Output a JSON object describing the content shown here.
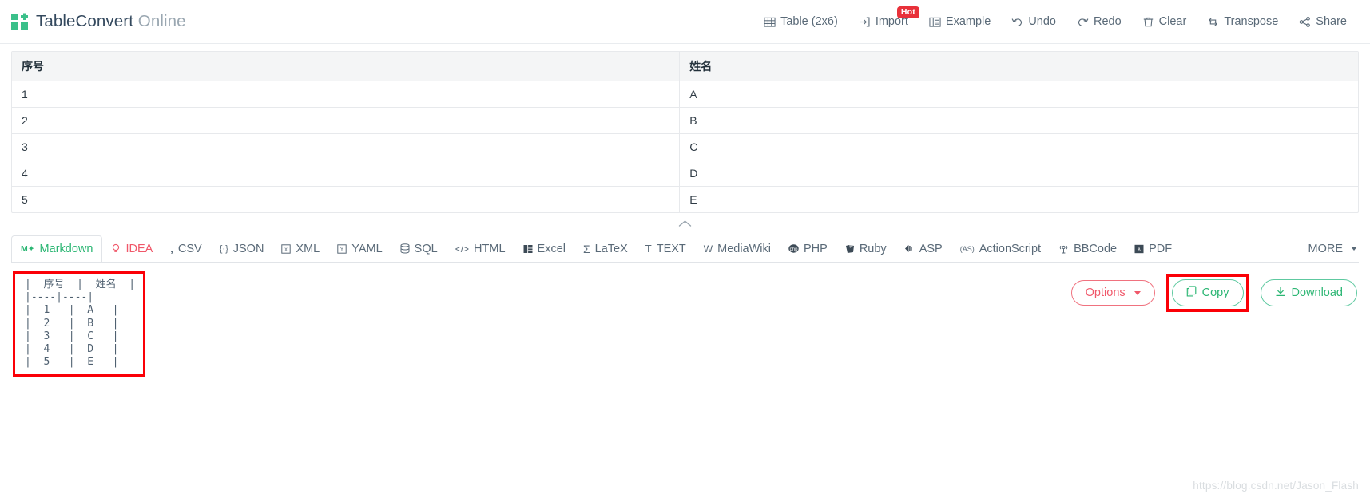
{
  "header": {
    "brand_main": "TableConvert",
    "brand_light": "Online",
    "logo_icon": "grid-squares-logo",
    "tools": [
      {
        "label": "Table (2x6)",
        "icon": "table-icon",
        "badge": null
      },
      {
        "label": "Import",
        "icon": "import-icon",
        "badge": "Hot"
      },
      {
        "label": "Example",
        "icon": "example-icon",
        "badge": null
      },
      {
        "label": "Undo",
        "icon": "undo-arrow-icon",
        "badge": null
      },
      {
        "label": "Redo",
        "icon": "redo-arrow-icon",
        "badge": null
      },
      {
        "label": "Clear",
        "icon": "trash-icon",
        "badge": null
      },
      {
        "label": "Transpose",
        "icon": "transpose-icon",
        "badge": null
      },
      {
        "label": "Share",
        "icon": "share-icon",
        "badge": null
      }
    ]
  },
  "table": {
    "columns": [
      "序号",
      "姓名"
    ],
    "rows": [
      [
        "1",
        "A"
      ],
      [
        "2",
        "B"
      ],
      [
        "3",
        "C"
      ],
      [
        "4",
        "D"
      ],
      [
        "5",
        "E"
      ]
    ]
  },
  "collapse": {
    "icon": "chevron-up-icon"
  },
  "format_tabs": {
    "active": "Markdown",
    "items": [
      {
        "label": "Markdown",
        "icon": "markdown-icon",
        "glyph": "M+",
        "state": "active"
      },
      {
        "label": "IDEA",
        "icon": "idea-bulb-icon",
        "glyph": "⚲",
        "state": "accent"
      },
      {
        "label": "CSV",
        "icon": "csv-comma-icon",
        "glyph": "’",
        "state": "normal"
      },
      {
        "label": "JSON",
        "icon": "json-braces-icon",
        "glyph": "{·}",
        "state": "normal"
      },
      {
        "label": "XML",
        "icon": "xml-icon",
        "glyph": "☒",
        "state": "normal"
      },
      {
        "label": "YAML",
        "icon": "yaml-icon",
        "glyph": "☐",
        "state": "normal"
      },
      {
        "label": "SQL",
        "icon": "database-icon",
        "glyph": "⌸",
        "state": "normal"
      },
      {
        "label": "HTML",
        "icon": "code-tags-icon",
        "glyph": "</>",
        "state": "normal"
      },
      {
        "label": "Excel",
        "icon": "excel-icon",
        "glyph": "▣",
        "state": "normal"
      },
      {
        "label": "LaTeX",
        "icon": "sigma-icon",
        "glyph": "Σ",
        "state": "normal"
      },
      {
        "label": "TEXT",
        "icon": "text-t-icon",
        "glyph": "T",
        "state": "normal"
      },
      {
        "label": "MediaWiki",
        "icon": "mediawiki-w-icon",
        "glyph": "W",
        "state": "normal"
      },
      {
        "label": "PHP",
        "icon": "php-icon",
        "glyph": "●",
        "state": "normal"
      },
      {
        "label": "Ruby",
        "icon": "ruby-gem-icon",
        "glyph": "◢",
        "state": "normal"
      },
      {
        "label": "ASP",
        "icon": "asp-icon",
        "glyph": "◀",
        "state": "normal"
      },
      {
        "label": "ActionScript",
        "icon": "actionscript-icon",
        "glyph": "(AS)",
        "state": "normal"
      },
      {
        "label": "BBCode",
        "icon": "bbcode-antenna-icon",
        "glyph": "☢",
        "state": "normal"
      },
      {
        "label": "PDF",
        "icon": "pdf-icon",
        "glyph": "◤",
        "state": "normal"
      }
    ],
    "more_label": "MORE"
  },
  "output": {
    "code": "|  序号  |  姓名  |\n|----|----|\n|  1   |  A   |\n|  2   |  B   |\n|  3   |  C   |\n|  4   |  D   |\n|  5   |  E   |",
    "options_label": "Options",
    "copy_label": "Copy",
    "download_label": "Download",
    "copy_icon": "copy-pages-icon",
    "download_icon": "download-arrow-icon"
  },
  "watermark": "https://blog.csdn.net/Jason_Flash",
  "colors": {
    "accent_green": "#2bb673",
    "accent_red": "#f0586a",
    "highlight_box": "#fb0007",
    "hot_badge": "#e8313a",
    "text": "#5a6a78"
  }
}
